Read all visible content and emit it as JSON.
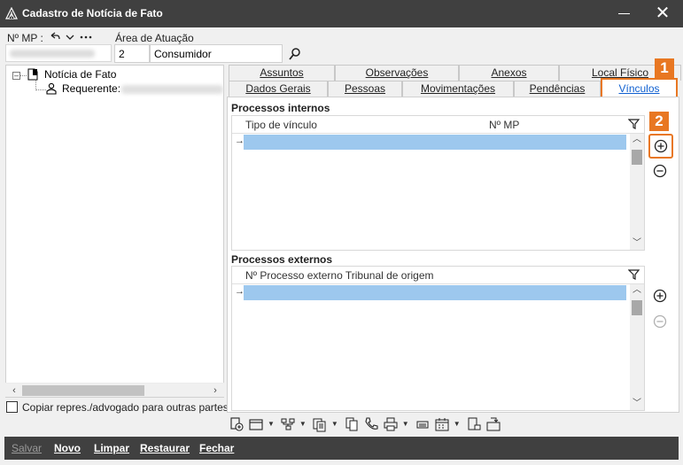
{
  "window": {
    "title": "Cadastro de Notícia de Fato",
    "minimize_label": "",
    "close_label": "✕"
  },
  "header": {
    "nmp_label": "Nº MP :",
    "area_label": "Área de Atuação",
    "area_code": "2",
    "area_name": "Consumidor"
  },
  "tree": {
    "root_label": "Notícia de Fato",
    "child_label": "Requerente:"
  },
  "options": {
    "copy_label": "Copiar repres./advogado para outras partes"
  },
  "tabs": {
    "row1": [
      "Assuntos",
      "Observações",
      "Anexos",
      "Local Físico"
    ],
    "row2": [
      "Dados Gerais",
      "Pessoas",
      "Movimentações",
      "Pendências",
      "Vínculos"
    ]
  },
  "internos": {
    "title": "Processos internos",
    "col_tipo": "Tipo de vínculo",
    "col_nmp": "Nº MP"
  },
  "externos": {
    "title": "Processos externos",
    "col_processo": "Nº Processo externo Tribunal de origem"
  },
  "callouts": {
    "first": "1",
    "second": "2"
  },
  "footer": {
    "salvar": "Salvar",
    "novo": "Novo",
    "limpar": "Limpar",
    "restaurar": "Restaurar",
    "fechar": "Fechar"
  },
  "colors": {
    "accent": "#e87722",
    "selection": "#9dc8ee",
    "titlebar": "#404040",
    "link": "#1060d0"
  }
}
